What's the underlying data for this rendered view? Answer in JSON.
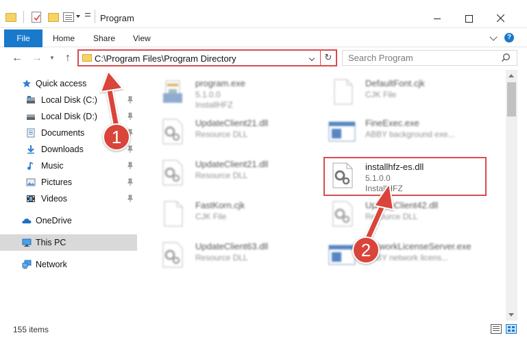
{
  "window": {
    "title": "Program"
  },
  "ribbon": {
    "tabs": [
      "File",
      "Home",
      "Share",
      "View"
    ],
    "help": "?"
  },
  "address": {
    "path": "C:\\Program Files\\Program Directory"
  },
  "search": {
    "placeholder": "Search Program"
  },
  "nav": {
    "items": [
      {
        "label": "Quick access",
        "icon": "star-icon"
      },
      {
        "label": "Local Disk (C:)",
        "icon": "drive-icon",
        "pinned": true
      },
      {
        "label": "Local Disk (D:)",
        "icon": "drive-icon",
        "pinned": true
      },
      {
        "label": "Documents",
        "icon": "documents-icon",
        "pinned": true
      },
      {
        "label": "Downloads",
        "icon": "downloads-icon",
        "pinned": true
      },
      {
        "label": "Music",
        "icon": "music-icon",
        "pinned": true
      },
      {
        "label": "Pictures",
        "icon": "pictures-icon",
        "pinned": true
      },
      {
        "label": "Videos",
        "icon": "videos-icon",
        "pinned": true
      },
      {
        "label": "OneDrive",
        "icon": "onedrive-icon"
      },
      {
        "label": "This PC",
        "icon": "this-pc-icon",
        "selected": true
      },
      {
        "label": "Network",
        "icon": "network-icon"
      }
    ]
  },
  "files": [
    {
      "name": "program.exe",
      "line1": "5.1.0.0",
      "line2": "InstallHFZ",
      "icon": "exe-icon"
    },
    {
      "name": "DefaultFont.cjk",
      "line1": "CJK File",
      "line2": "",
      "icon": "file-icon"
    },
    {
      "name": "UpdateClient21.dll",
      "line1": "Resource DLL",
      "line2": "",
      "icon": "dll-icon"
    },
    {
      "name": "FineExec.exe",
      "line1": "ABBY background exe...",
      "line2": "",
      "icon": "app-window-icon"
    },
    {
      "name": "UpdateClient21.dll",
      "line1": "Resource DLL",
      "line2": "",
      "icon": "dll-icon"
    },
    {
      "name": "installhfz-es.dll",
      "line1": "5.1.0.0",
      "line2": "InstallHFZ",
      "icon": "dll-icon"
    },
    {
      "name": "FastKorn.cjk",
      "line1": "CJK File",
      "line2": "",
      "icon": "file-icon"
    },
    {
      "name": "UpdateClient42.dll",
      "line1": "Resource DLL",
      "line2": "",
      "icon": "dll-icon"
    },
    {
      "name": "UpdateClient63.dll",
      "line1": "Resource DLL",
      "line2": "",
      "icon": "dll-icon"
    },
    {
      "name": "NetworkLicenseServer.exe",
      "line1": "ABBY network licens...",
      "line2": "",
      "icon": "app-window-icon"
    }
  ],
  "status": {
    "item_count": "155 items"
  },
  "annotations": {
    "badge1": "1",
    "badge2": "2"
  },
  "colors": {
    "accent": "#1979ca",
    "highlight": "#d94b4b",
    "badge": "#d9453a",
    "selection": "#cce8ff"
  }
}
